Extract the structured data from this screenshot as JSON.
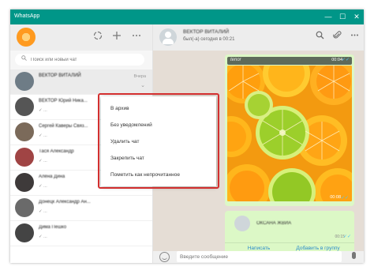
{
  "window": {
    "title": "WhatsApp",
    "controls": {
      "minimize": "—",
      "maximize": "☐",
      "close": "✕"
    }
  },
  "sidebar": {
    "search": {
      "placeholder": "Поиск или новый чат"
    },
    "chats": [
      {
        "name": "ВЕКТОР ВИТАЛИЙ",
        "preview": "",
        "time": "Вчера",
        "active": true
      },
      {
        "name": "ВЕКТОР Юрий Ника...",
        "preview": "✓ ...",
        "time": "",
        "active": false
      },
      {
        "name": "Сергей Каверы Связ...",
        "preview": "✓ ...",
        "time": "",
        "active": false
      },
      {
        "name": "Тася Александр",
        "preview": "✓ ...",
        "time": "",
        "active": false
      },
      {
        "name": "Алёна Дина",
        "preview": "✓ ...",
        "time": "",
        "active": false
      },
      {
        "name": "Донецк Александр Ан...",
        "preview": "✓ ...",
        "time": "",
        "active": false
      },
      {
        "name": "Дима Пешко",
        "preview": "✓ ...",
        "time": "",
        "active": false
      }
    ]
  },
  "main": {
    "peer": {
      "name": "ВЕКТОР ВИТАЛИЙ",
      "status": "был(-а) сегодня в 00:21"
    },
    "image_message": {
      "tag": "tenor",
      "top_time": "00:04",
      "bottom_time": "00:08"
    },
    "contact_message": {
      "name": "ОКСАНА ЖВИА",
      "time": "00:15",
      "actions": [
        "Написать",
        "Добавить в группу"
      ]
    },
    "composer": {
      "placeholder": "Введите сообщение"
    }
  },
  "context_menu": {
    "items": [
      "В архив",
      "Без уведомлений",
      "Удалить чат",
      "Закрепить чат",
      "Пометить как непрочитанное"
    ]
  },
  "colors": {
    "titlebar": "#009688",
    "bubble": "#dcf8c6",
    "highlight": "#d32f2f",
    "link": "#2a8bc9"
  }
}
